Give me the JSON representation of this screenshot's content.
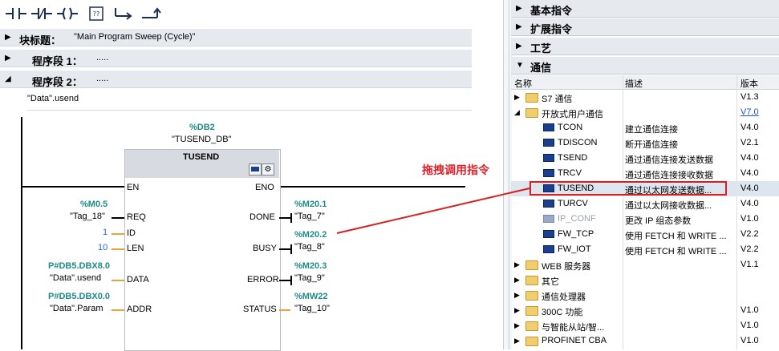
{
  "toolbar": {
    "icons": [
      "no-contact-icon",
      "nc-contact-icon",
      "coil-icon",
      "empty-box-icon",
      "open-branch-icon",
      "close-branch-icon"
    ]
  },
  "block_title": {
    "label": "块标题：",
    "value": "\"Main Program Sweep (Cycle)\""
  },
  "networks": [
    {
      "label": "程序段 1：",
      "comment": "....."
    },
    {
      "label": "程序段 2：",
      "comment": "....."
    }
  ],
  "network2_comment": "\"Data\".usend",
  "fb": {
    "instance_address": "%DB2",
    "instance_name": "\"TUSEND_DB\"",
    "name": "TUSEND",
    "inputs": [
      {
        "pin": "EN"
      },
      {
        "pin": "REQ",
        "address": "%M0.5",
        "tag": "\"Tag_18\""
      },
      {
        "pin": "ID",
        "value": "1"
      },
      {
        "pin": "LEN",
        "value": "10"
      },
      {
        "pin": "DATA",
        "address": "P#DB5.DBX8.0",
        "tag": "\"Data\".usend"
      },
      {
        "pin": "ADDR",
        "address": "P#DB5.DBX0.0",
        "tag": "\"Data\".Param"
      }
    ],
    "outputs": [
      {
        "pin": "ENO"
      },
      {
        "pin": "DONE",
        "address": "%M20.1",
        "tag": "\"Tag_7\""
      },
      {
        "pin": "BUSY",
        "address": "%M20.2",
        "tag": "\"Tag_8\""
      },
      {
        "pin": "ERROR",
        "address": "%M20.3",
        "tag": "\"Tag_9\""
      },
      {
        "pin": "STATUS",
        "address": "%MW22",
        "tag": "\"Tag_10\""
      }
    ]
  },
  "annotation": "拖拽调用指令",
  "colors": {
    "teal": "#1e8a8a",
    "annotation_red": "#e0202a",
    "selection_red": "#d42020",
    "link_blue": "#1a4fd6"
  },
  "instructions_panel": {
    "categories": [
      {
        "label": "基本指令",
        "expanded": false
      },
      {
        "label": "扩展指令",
        "expanded": false
      },
      {
        "label": "工艺",
        "expanded": false
      },
      {
        "label": "通信",
        "expanded": true
      }
    ],
    "columns": {
      "name": "名称",
      "description": "描述",
      "version": "版本"
    },
    "rows": [
      {
        "name": "S7 通信",
        "description": "",
        "version": "V1.3",
        "type": "folder",
        "level": 0,
        "expander": "▶"
      },
      {
        "name": "开放式用户通信",
        "description": "",
        "version": "V7.0",
        "type": "folder",
        "level": 0,
        "expander": "◢"
      },
      {
        "name": "TCON",
        "description": "建立通信连接",
        "version": "V4.0",
        "type": "block",
        "level": 1
      },
      {
        "name": "TDISCON",
        "description": "断开通信连接",
        "version": "V2.1",
        "type": "block",
        "level": 1
      },
      {
        "name": "TSEND",
        "description": "通过通信连接发送数据",
        "version": "V4.0",
        "type": "block",
        "level": 1
      },
      {
        "name": "TRCV",
        "description": "通过通信连接接收数据",
        "version": "V4.0",
        "type": "block",
        "level": 1
      },
      {
        "name": "TUSEND",
        "description": "通过以太网发送数据...",
        "version": "V4.0",
        "type": "block",
        "level": 1,
        "selected": true
      },
      {
        "name": "TURCV",
        "description": "通过以太网接收数据...",
        "version": "V4.0",
        "type": "block",
        "level": 1
      },
      {
        "name": "IP_CONF",
        "description": "更改 IP 组态参数",
        "version": "V1.0",
        "type": "block-disabled",
        "level": 1
      },
      {
        "name": "FW_TCP",
        "description": "使用 FETCH 和 WRITE ...",
        "version": "V2.2",
        "type": "block",
        "level": 1
      },
      {
        "name": "FW_IOT",
        "description": "使用 FETCH 和 WRITE ...",
        "version": "V2.2",
        "type": "block",
        "level": 1
      },
      {
        "name": "WEB 服务器",
        "description": "",
        "version": "V1.1",
        "type": "folder",
        "level": 0,
        "expander": "▶"
      },
      {
        "name": "其它",
        "description": "",
        "version": "",
        "type": "folder",
        "level": 0,
        "expander": "▶"
      },
      {
        "name": "通信处理器",
        "description": "",
        "version": "",
        "type": "folder",
        "level": 0,
        "expander": "▶"
      },
      {
        "name": "300C 功能",
        "description": "",
        "version": "V1.0",
        "type": "folder",
        "level": 0,
        "expander": "▶"
      },
      {
        "name": "与智能从站/智...",
        "description": "",
        "version": "V1.0",
        "type": "folder",
        "level": 0,
        "expander": "▶"
      },
      {
        "name": "PROFINET CBA",
        "description": "",
        "version": "V1.0",
        "type": "folder",
        "level": 0,
        "expander": "▶"
      }
    ]
  }
}
